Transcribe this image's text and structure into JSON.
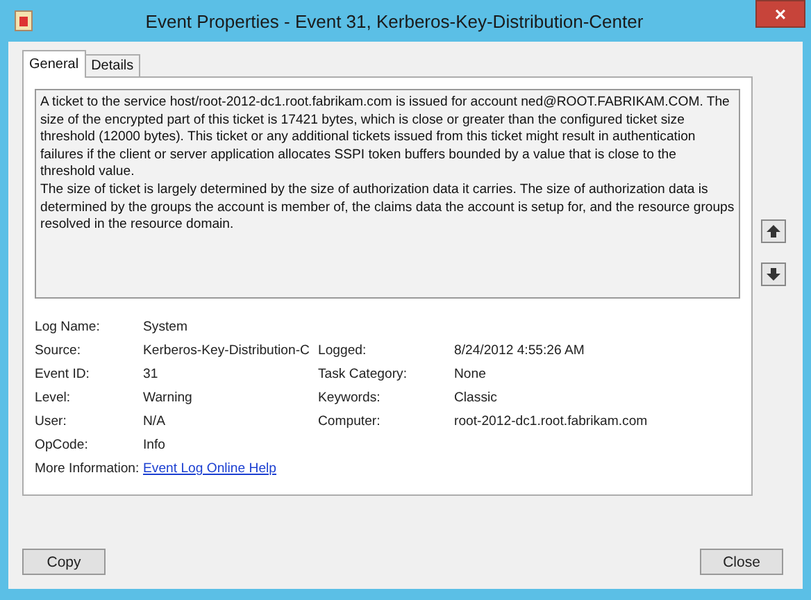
{
  "window": {
    "title": "Event Properties - Event 31, Kerberos-Key-Distribution-Center",
    "close": "×"
  },
  "tabs": [
    {
      "label": "General",
      "selected": true
    },
    {
      "label": "Details",
      "selected": false
    }
  ],
  "message": [
    "A ticket to the service host/root-2012-dc1.root.fabrikam.com is issued for account ned@ROOT.FABRIKAM.COM. The size of the encrypted part of this ticket is 17421 bytes, which is close or greater than the configured ticket size threshold (12000 bytes). This ticket or any additional tickets issued from this ticket might result in authentication failures if the client or server application allocates SSPI token buffers bounded by a value that is close to the threshold value.",
    "The size of ticket is largely determined by the size of authorization data it carries. The size of authorization data is determined by the groups the account is member of, the claims data the account is setup for, and the resource groups resolved in the resource domain."
  ],
  "fields": [
    {
      "label": "Log Name:",
      "value": "System"
    },
    {
      "label": "Source:",
      "value": "Kerberos-Key-Distribution-C",
      "label2": "Logged:",
      "value2": "8/24/2012 4:55:26 AM"
    },
    {
      "label": "Event ID:",
      "value": "31",
      "label2": "Task Category:",
      "value2": "None"
    },
    {
      "label": "Level:",
      "value": "Warning",
      "label2": "Keywords:",
      "value2": "Classic"
    },
    {
      "label": "User:",
      "value": "N/A",
      "label2": "Computer:",
      "value2": "root-2012-dc1.root.fabrikam.com"
    },
    {
      "label": "OpCode:",
      "value": "Info"
    },
    {
      "label": "More Information:",
      "value": "Event Log Online Help",
      "kind": "link"
    }
  ],
  "buttons": [
    "Copy",
    "Close"
  ]
}
